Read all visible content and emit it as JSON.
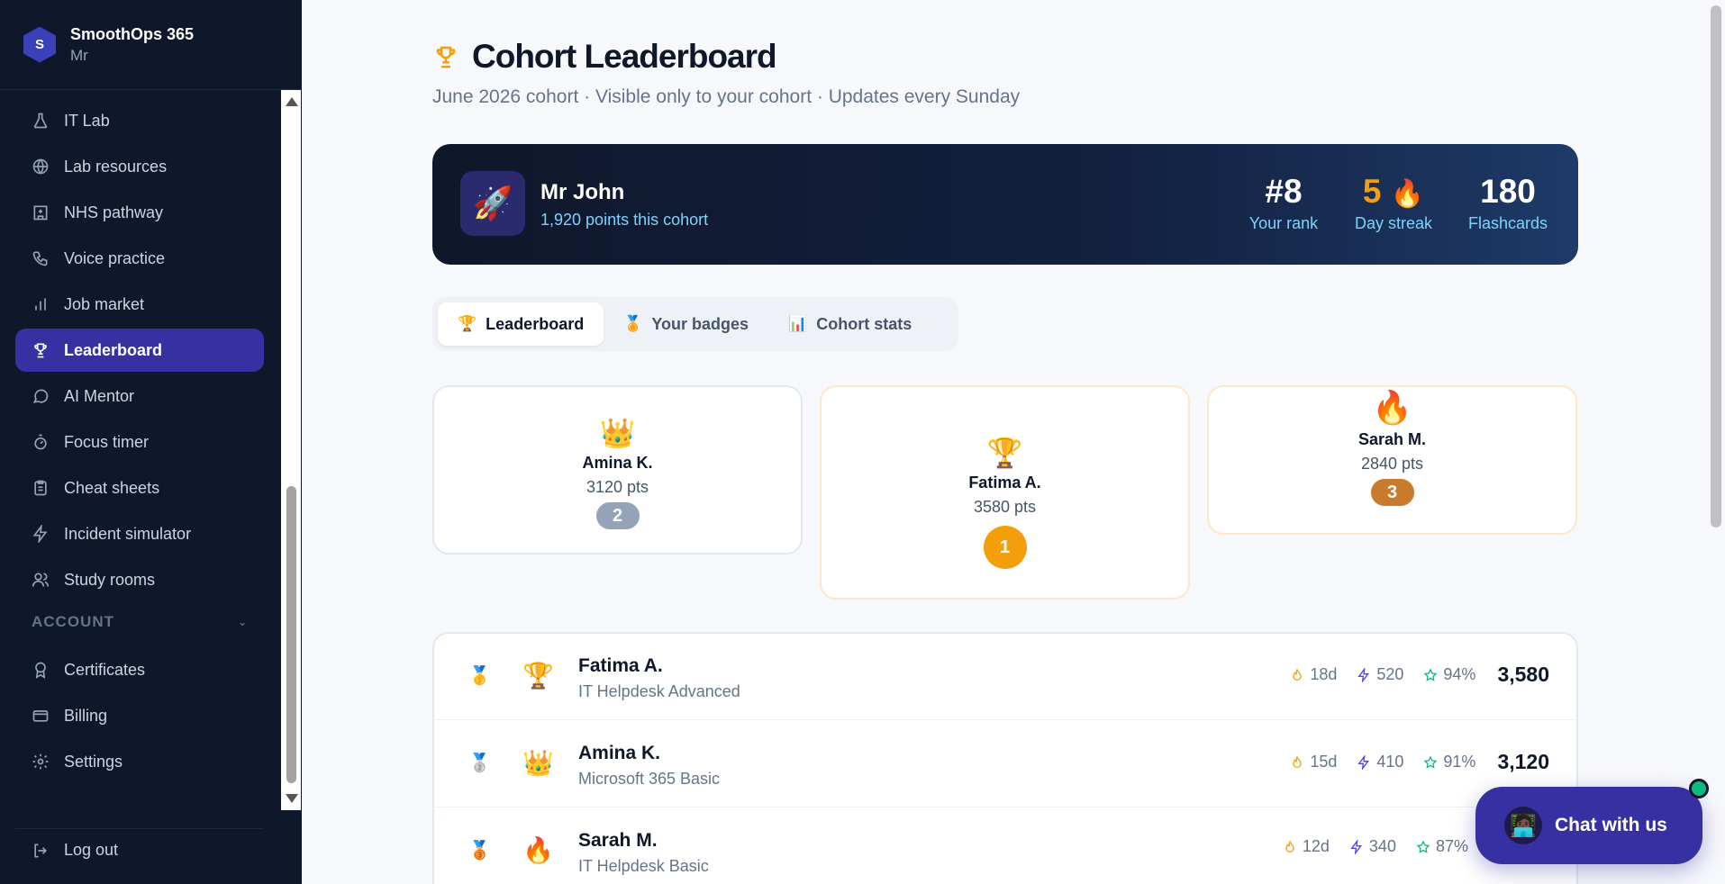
{
  "brand": {
    "name": "SmoothOps 365",
    "user": "Mr",
    "logo_letter": "S"
  },
  "sidebar": {
    "items": [
      {
        "label": "IT Lab",
        "icon": "flask-icon"
      },
      {
        "label": "Lab resources",
        "icon": "globe-icon"
      },
      {
        "label": "NHS pathway",
        "icon": "hospital-icon"
      },
      {
        "label": "Voice practice",
        "icon": "phone-icon"
      },
      {
        "label": "Job market",
        "icon": "bar-chart-icon"
      },
      {
        "label": "Leaderboard",
        "icon": "trophy-icon",
        "active": true
      },
      {
        "label": "AI Mentor",
        "icon": "chat-bubble-icon"
      },
      {
        "label": "Focus timer",
        "icon": "stopwatch-icon"
      },
      {
        "label": "Cheat sheets",
        "icon": "clipboard-icon"
      },
      {
        "label": "Incident simulator",
        "icon": "bolt-icon"
      },
      {
        "label": "Study rooms",
        "icon": "users-icon"
      }
    ],
    "account_section": "ACCOUNT",
    "account_items": [
      {
        "label": "Certificates",
        "icon": "award-icon"
      },
      {
        "label": "Billing",
        "icon": "credit-card-icon"
      },
      {
        "label": "Settings",
        "icon": "gear-icon"
      }
    ],
    "logout": "Log out"
  },
  "page": {
    "title": "Cohort Leaderboard",
    "subtitle": "June 2026 cohort · Visible only to your cohort · Updates every Sunday"
  },
  "hero": {
    "avatar_emoji": "🚀",
    "name": "Mr John",
    "points": "1,920 points this cohort",
    "rank_value": "#8",
    "rank_label": "Your rank",
    "streak_value": "5",
    "streak_emoji": "🔥",
    "streak_label": "Day streak",
    "flashcards_value": "180",
    "flashcards_label": "Flashcards"
  },
  "tabs": [
    {
      "label": "Leaderboard",
      "icon": "🏆",
      "active": true
    },
    {
      "label": "Your badges",
      "icon": "🏅"
    },
    {
      "label": "Cohort stats",
      "icon": "📊"
    }
  ],
  "podium": [
    {
      "place": "2",
      "name": "Amina K.",
      "pts": "3120 pts",
      "emoji": "👑",
      "color": "#94a3b8"
    },
    {
      "place": "1",
      "name": "Fatima A.",
      "pts": "3580 pts",
      "emoji": "🏆",
      "color": "#f59e0b"
    },
    {
      "place": "3",
      "name": "Sarah M.",
      "pts": "2840 pts",
      "emoji": "🔥",
      "color": "#c97a2c"
    }
  ],
  "rows": [
    {
      "medal": "🥇",
      "emoji": "🏆",
      "name": "Fatima A.",
      "sub": "IT Helpdesk Advanced",
      "streak": "18d",
      "xp": "520",
      "acc": "94%",
      "score": "3,580"
    },
    {
      "medal": "🥈",
      "emoji": "👑",
      "name": "Amina K.",
      "sub": "Microsoft 365 Basic",
      "streak": "15d",
      "xp": "410",
      "acc": "91%",
      "score": "3,120"
    },
    {
      "medal": "🥉",
      "emoji": "🔥",
      "name": "Sarah M.",
      "sub": "IT Helpdesk Basic",
      "streak": "12d",
      "xp": "340",
      "acc": "87%",
      "score": ""
    }
  ],
  "chat": {
    "label": "Chat with us",
    "avatar": "🧑🏿‍💻"
  },
  "colors": {
    "accent": "#3730a3",
    "sidebar_bg": "#0f172a",
    "gold": "#f59e0b",
    "silver": "#94a3b8",
    "bronze": "#c97a2c"
  }
}
